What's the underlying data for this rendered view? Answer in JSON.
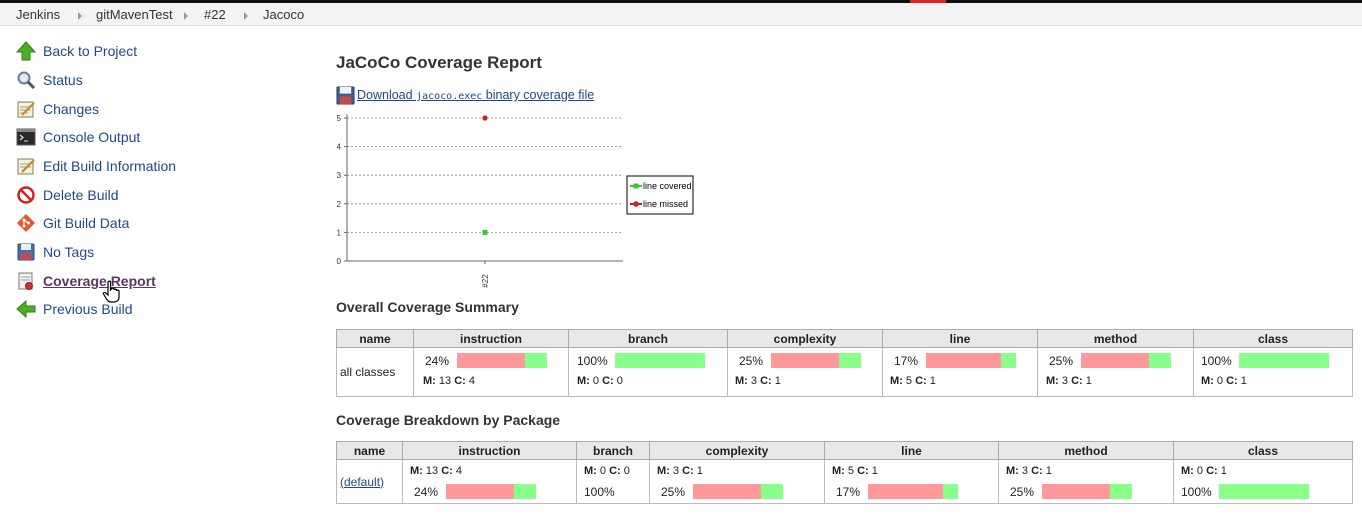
{
  "breadcrumbs": [
    "Jenkins",
    "gitMavenTest",
    "#22",
    "Jacoco"
  ],
  "sidebar": {
    "items": [
      {
        "label": "Back to Project",
        "icon": "up-arrow-icon"
      },
      {
        "label": "Status",
        "icon": "magnifier-icon"
      },
      {
        "label": "Changes",
        "icon": "notepad-icon"
      },
      {
        "label": "Console Output",
        "icon": "terminal-icon"
      },
      {
        "label": "Edit Build Information",
        "icon": "notepad-pencil-icon"
      },
      {
        "label": "Delete Build",
        "icon": "no-entry-icon"
      },
      {
        "label": "Git Build Data",
        "icon": "git-icon"
      },
      {
        "label": "No Tags",
        "icon": "floppy-disk-icon"
      },
      {
        "label": "Coverage Report",
        "icon": "report-graph-icon"
      },
      {
        "label": "Previous Build",
        "icon": "left-arrow-icon"
      }
    ]
  },
  "page_title": "JaCoCo Coverage Report",
  "download": {
    "prefix": "Download ",
    "filename": "jacoco.exec",
    "suffix": " binary coverage file"
  },
  "chart_data": {
    "type": "scatter",
    "categories": [
      "#22"
    ],
    "series": [
      {
        "name": "line covered",
        "values": [
          1
        ],
        "color": "#33cc33"
      },
      {
        "name": "line missed",
        "values": [
          5
        ],
        "color": "#cc2222"
      }
    ],
    "yticks": [
      0,
      1,
      2,
      3,
      4,
      5
    ],
    "ylim": [
      0,
      5
    ],
    "legend": "right"
  },
  "overall": {
    "heading": "Overall Coverage Summary",
    "columns": [
      "name",
      "instruction",
      "branch",
      "complexity",
      "line",
      "method",
      "class"
    ],
    "row": {
      "name": "all classes",
      "metrics": [
        {
          "pct": "24%",
          "fraction": 0.24,
          "m": "13",
          "c": "4"
        },
        {
          "pct": "100%",
          "fraction": 1.0,
          "m": "0",
          "c": "0"
        },
        {
          "pct": "25%",
          "fraction": 0.25,
          "m": "3",
          "c": "1"
        },
        {
          "pct": "17%",
          "fraction": 0.17,
          "m": "5",
          "c": "1"
        },
        {
          "pct": "25%",
          "fraction": 0.25,
          "m": "3",
          "c": "1"
        },
        {
          "pct": "100%",
          "fraction": 1.0,
          "m": "0",
          "c": "1"
        }
      ]
    }
  },
  "breakdown": {
    "heading": "Coverage Breakdown by Package",
    "columns": [
      "name",
      "instruction",
      "branch",
      "complexity",
      "line",
      "method",
      "class"
    ],
    "row": {
      "name": "(default)",
      "metrics": [
        {
          "pct": "24%",
          "fraction": 0.24,
          "m": "13",
          "c": "4"
        },
        {
          "pct": "100%",
          "fraction": 1.0,
          "m": "0",
          "c": "0"
        },
        {
          "pct": "25%",
          "fraction": 0.25,
          "m": "3",
          "c": "1"
        },
        {
          "pct": "17%",
          "fraction": 0.17,
          "m": "5",
          "c": "1"
        },
        {
          "pct": "25%",
          "fraction": 0.25,
          "m": "3",
          "c": "1"
        },
        {
          "pct": "100%",
          "fraction": 1.0,
          "m": "0",
          "c": "1"
        }
      ]
    }
  },
  "labels": {
    "m": "M:",
    "c": "C:"
  }
}
